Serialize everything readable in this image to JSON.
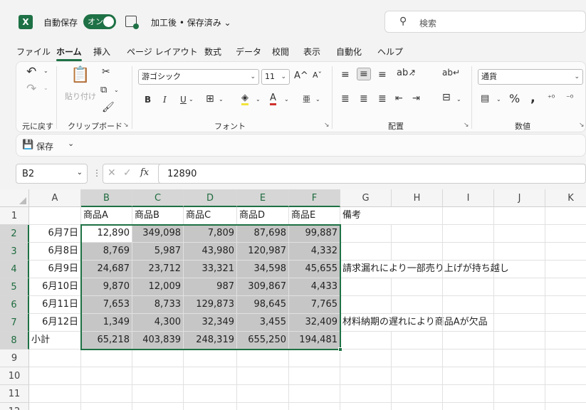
{
  "titlebar": {
    "app_icon": "X",
    "autosave_label": "自動保存",
    "toggle_label": "オン",
    "doc_title": "加工後 • 保存済み",
    "search_placeholder": "検索"
  },
  "tabs": [
    "ファイル",
    "ホーム",
    "挿入",
    "ページ レイアウト",
    "数式",
    "データ",
    "校閲",
    "表示",
    "自動化",
    "ヘルプ"
  ],
  "active_tab": "ホーム",
  "ribbon": {
    "undo_group": "元に戻す",
    "paste_label": "貼り付け",
    "clipboard_group": "クリップボード",
    "font_name": "游ゴシック",
    "font_size": "11",
    "bold": "B",
    "italic": "I",
    "underline": "U",
    "font_group": "フォント",
    "align_group": "配置",
    "number_format": "通貨",
    "number_group": "数値"
  },
  "qat": {
    "save_label": "保存"
  },
  "formula_bar": {
    "name_box": "B2",
    "fx": "fx",
    "value": "12890"
  },
  "columns": [
    "A",
    "B",
    "C",
    "D",
    "E",
    "F",
    "G",
    "H",
    "I",
    "J",
    "K"
  ],
  "rows": [
    {
      "n": "1",
      "A": "",
      "B": "商品A",
      "C": "商品B",
      "D": "商品C",
      "E": "商品D",
      "F": "商品E",
      "G": "備考"
    },
    {
      "n": "2",
      "A": "6月7日",
      "B": "12,890",
      "C": "349,098",
      "D": "7,809",
      "E": "87,698",
      "F": "99,887",
      "G": ""
    },
    {
      "n": "3",
      "A": "6月8日",
      "B": "8,769",
      "C": "5,987",
      "D": "43,980",
      "E": "120,987",
      "F": "4,332",
      "G": ""
    },
    {
      "n": "4",
      "A": "6月9日",
      "B": "24,687",
      "C": "23,712",
      "D": "33,321",
      "E": "34,598",
      "F": "45,655",
      "G": "請求漏れにより一部売り上げが持ち越し"
    },
    {
      "n": "5",
      "A": "6月10日",
      "B": "9,870",
      "C": "12,009",
      "D": "987",
      "E": "309,867",
      "F": "4,433",
      "G": ""
    },
    {
      "n": "6",
      "A": "6月11日",
      "B": "7,653",
      "C": "8,733",
      "D": "129,873",
      "E": "98,645",
      "F": "7,765",
      "G": ""
    },
    {
      "n": "7",
      "A": "6月12日",
      "B": "1,349",
      "C": "4,300",
      "D": "32,349",
      "E": "3,455",
      "F": "32,409",
      "G": "材料納期の遅れにより商品Aが欠品"
    },
    {
      "n": "8",
      "A": "小計",
      "B": "65,218",
      "C": "403,839",
      "D": "248,319",
      "E": "655,250",
      "F": "194,481",
      "G": ""
    },
    {
      "n": "9"
    },
    {
      "n": "10"
    },
    {
      "n": "11"
    },
    {
      "n": "12"
    }
  ]
}
